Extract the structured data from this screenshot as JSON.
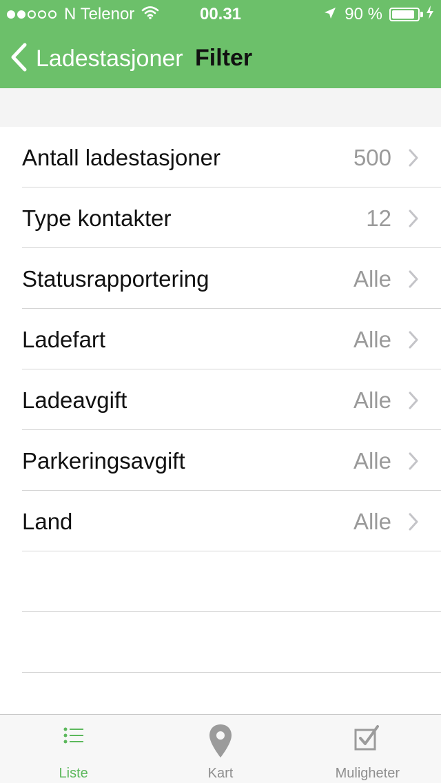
{
  "status_bar": {
    "carrier": "N Telenor",
    "time": "00.31",
    "battery_text": "90 %",
    "battery_level": 0.9,
    "signal_bars_filled": 2,
    "signal_bars_total": 5
  },
  "nav": {
    "back_label": "Ladestasjoner",
    "title": "Filter"
  },
  "filters": [
    {
      "label": "Antall ladestasjoner",
      "value": "500"
    },
    {
      "label": "Type kontakter",
      "value": "12"
    },
    {
      "label": "Statusrapportering",
      "value": "Alle"
    },
    {
      "label": "Ladefart",
      "value": "Alle"
    },
    {
      "label": "Ladeavgift",
      "value": "Alle"
    },
    {
      "label": "Parkeringsavgift",
      "value": "Alle"
    },
    {
      "label": "Land",
      "value": "Alle"
    }
  ],
  "tabs": [
    {
      "label": "Liste",
      "icon": "list-icon",
      "active": true
    },
    {
      "label": "Kart",
      "icon": "map-pin-icon",
      "active": false
    },
    {
      "label": "Muligheter",
      "icon": "checkbox-icon",
      "active": false
    }
  ],
  "colors": {
    "header": "#6cc06a",
    "accent": "#5cb85c",
    "value_text": "#9a9a9a",
    "tab_inactive": "#8e8e8e"
  }
}
